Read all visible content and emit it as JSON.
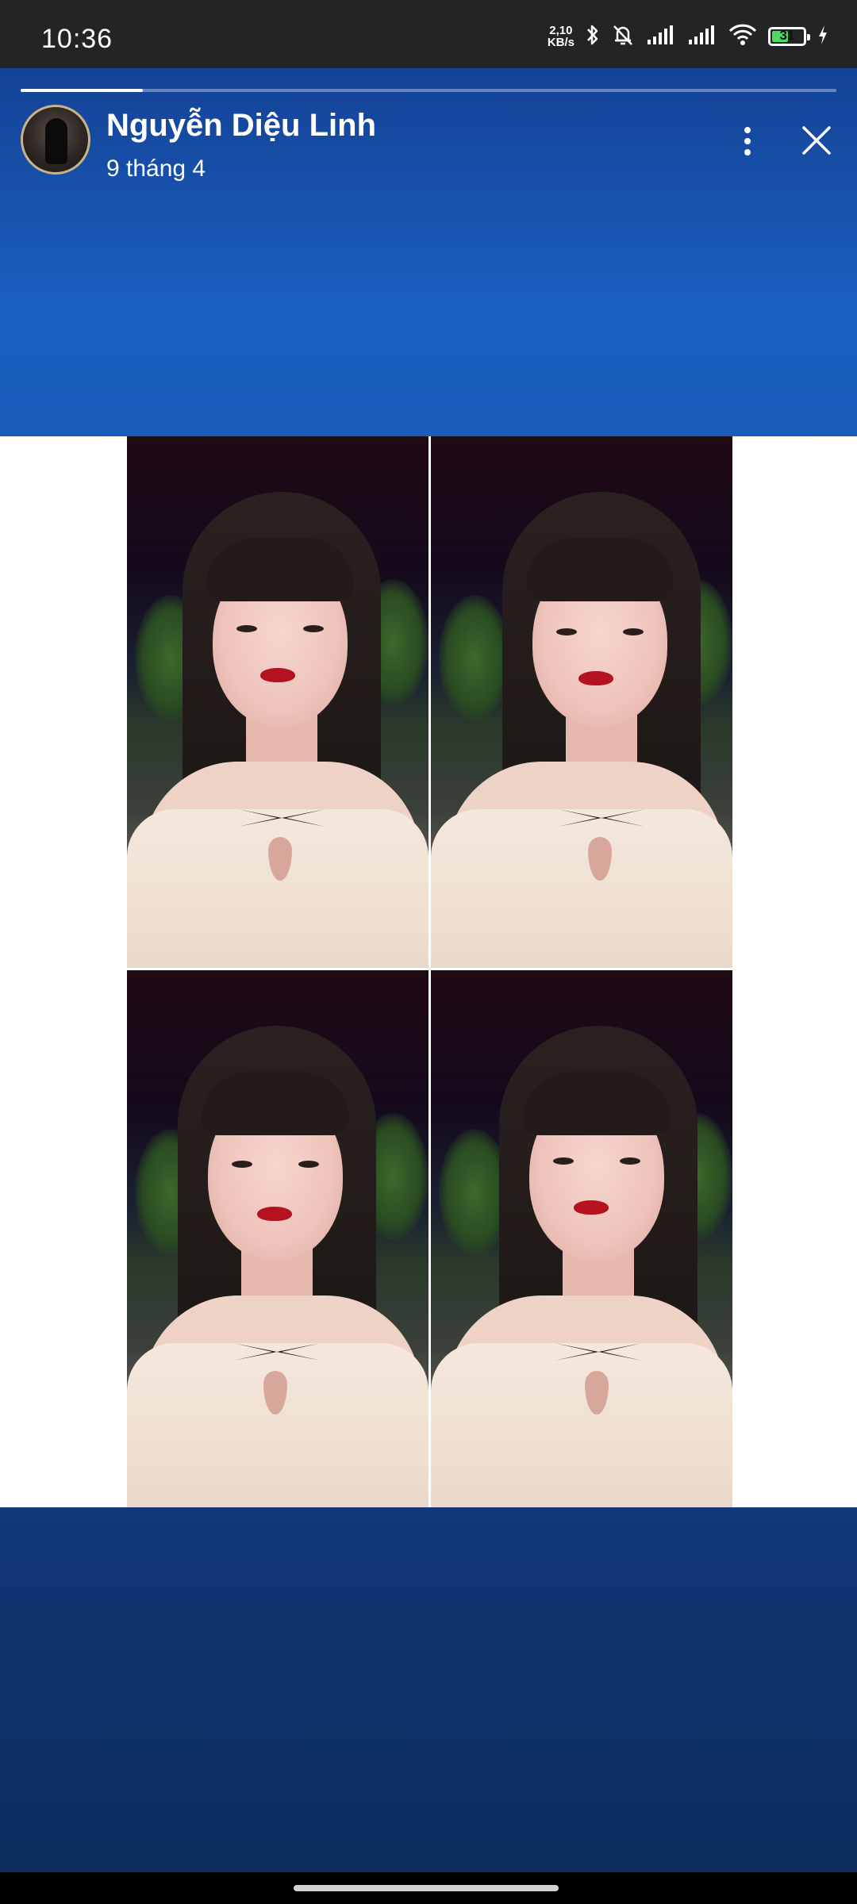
{
  "status_bar": {
    "time": "10:36",
    "net_speed_value": "2,10",
    "net_speed_unit": "KB/s",
    "battery_level": "31",
    "icons": [
      "bluetooth-icon",
      "silent-bell-icon",
      "signal-icon",
      "signal-icon",
      "wifi-icon",
      "battery-icon",
      "charging-icon"
    ]
  },
  "story": {
    "progress_fraction": 0.15,
    "user_name": "Nguyễn Diệu Linh",
    "date": "9 tháng 4",
    "more_icon": "more-vertical-icon",
    "close_icon": "close-icon",
    "photo_count": 4
  },
  "colors": {
    "background_top": "#1a5fbf",
    "background_bottom": "#0b2a5c",
    "battery_fill": "#4cd964",
    "lips": "#b5121f"
  }
}
